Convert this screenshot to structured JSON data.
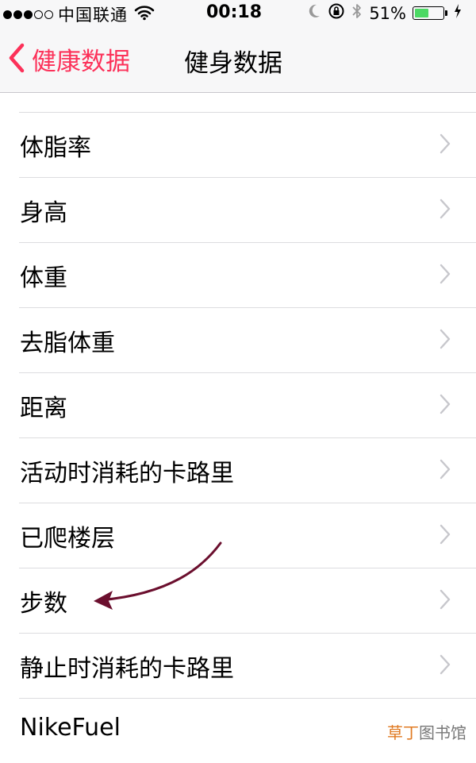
{
  "status_bar": {
    "carrier": "中国联通",
    "time": "00:18",
    "battery_percent": "51%",
    "battery_level": 0.51,
    "signal_bars_full": 3,
    "signal_bars_total": 5,
    "icons": [
      "wifi-icon",
      "moon-icon",
      "rotation-lock-icon",
      "bluetooth-icon",
      "battery-icon",
      "charging-icon"
    ]
  },
  "nav": {
    "back_label": "健康数据",
    "title": "健身数据",
    "accent_color": "#fc3159"
  },
  "list": {
    "items": [
      {
        "label": "体脂率"
      },
      {
        "label": "身高"
      },
      {
        "label": "体重"
      },
      {
        "label": "去脂体重"
      },
      {
        "label": "距离"
      },
      {
        "label": "活动时消耗的卡路里"
      },
      {
        "label": "已爬楼层"
      },
      {
        "label": "步数"
      },
      {
        "label": "静止时消耗的卡路里"
      },
      {
        "label": "NikeFuel"
      }
    ]
  },
  "annotation": {
    "arrow_color": "#6b0f2e",
    "points_to": "步数"
  },
  "watermark": {
    "part1": "草丁",
    "part2": "图书馆"
  }
}
